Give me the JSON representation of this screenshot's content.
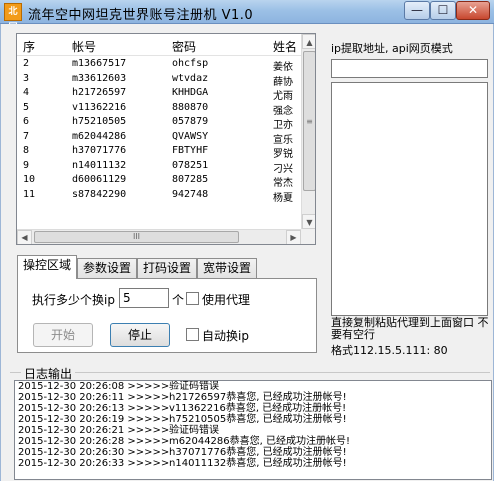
{
  "window": {
    "icon_text": "北冥",
    "title": "流年空中网坦克世界账号注册机    V1.0",
    "minimize": "—",
    "maximize": "☐",
    "close": "✕"
  },
  "accounts": {
    "headers": [
      "序",
      "帐号",
      "密码",
      "姓名"
    ],
    "rows": [
      [
        "2",
        "m13667517",
        "ohcfsp",
        "姜依"
      ],
      [
        "3",
        "m33612603",
        "wtvdaz",
        "薛协"
      ],
      [
        "4",
        "h21726597",
        "KHHDGA",
        "尤雨"
      ],
      [
        "5",
        "v11362216",
        "880870",
        "强念"
      ],
      [
        "6",
        "h75210505",
        "057879",
        "卫亦"
      ],
      [
        "7",
        "m62044286",
        "QVAWSY",
        "宣乐"
      ],
      [
        "8",
        "h37071776",
        "FBTYHF",
        "罗锐"
      ],
      [
        "9",
        "n14011132",
        "078251",
        "刁兴"
      ],
      [
        "10",
        "d60061129",
        "807285",
        "常杰"
      ],
      [
        "11",
        "s87842290",
        "942748",
        "杨夏"
      ]
    ],
    "scroll_up": "▲",
    "scroll_down": "▼",
    "scroll_left": "◀",
    "scroll_right": "▶",
    "vthumb_grip": "≡",
    "hthumb_grip": "III"
  },
  "tabs": [
    "操控区域",
    "参数设置",
    "打码设置",
    "宽带设置"
  ],
  "control": {
    "count_label": "执行多少个换ip",
    "count_value": "5",
    "count_unit": "个",
    "use_proxy_label": "使用代理",
    "start_label": "开始",
    "stop_label": "停止",
    "auto_ip_label": "自动换ip"
  },
  "proxy": {
    "title": "ip提取地址, api网页模式",
    "url_value": "",
    "note": "直接复制粘贴代理到上面窗口 不要有空行",
    "format": "格式112.15.5.111: 80"
  },
  "log": {
    "title": "日志输出",
    "lines": [
      [
        "2015-12-30  20:26:08  >>>>>",
        "验证码错误"
      ],
      [
        "2015-12-30  20:26:11  >>>>>",
        "h21726597恭喜您, 已经成功注册帐号!"
      ],
      [
        "2015-12-30  20:26:13  >>>>>",
        "v11362216恭喜您, 已经成功注册帐号!"
      ],
      [
        "2015-12-30  20:26:19  >>>>>",
        "h75210505恭喜您, 已经成功注册帐号!"
      ],
      [
        "2015-12-30  20:26:21  >>>>>",
        "验证码错误"
      ],
      [
        "2015-12-30  20:26:28  >>>>>",
        "m62044286恭喜您, 已经成功注册帐号!"
      ],
      [
        "2015-12-30  20:26:30  >>>>>",
        "h37071776恭喜您, 已经成功注册帐号!"
      ],
      [
        "2015-12-30  20:26:33  >>>>>",
        "n14011132恭喜您, 已经成功注册帐号!"
      ]
    ]
  }
}
